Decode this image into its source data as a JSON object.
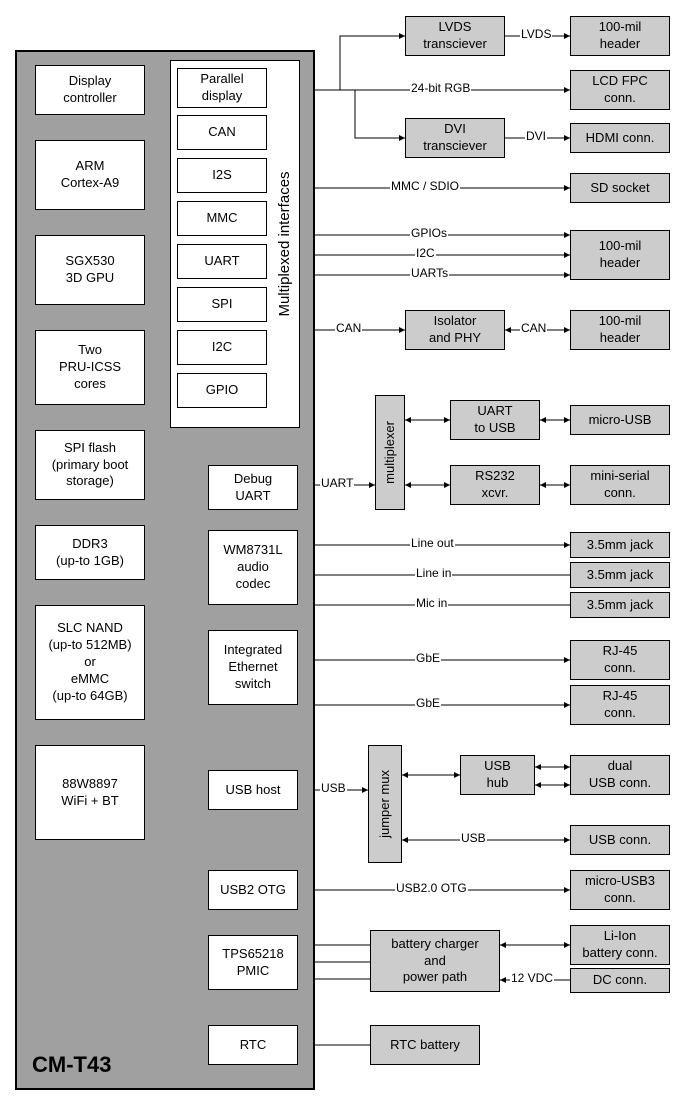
{
  "chip_label": "CM-T43",
  "mux_label": "Multiplexed interfaces",
  "modules": {
    "disp": "Display\ncontroller",
    "arm": "ARM\nCortex-A9",
    "gpu": "SGX530\n3D GPU",
    "pru": "Two\nPRU-ICSS\ncores",
    "spiflash": "SPI flash\n(primary boot\nstorage)",
    "ddr": "DDR3\n(up-to 1GB)",
    "nand": "SLC NAND\n(up-to 512MB)\nor\neMMC\n(up-to 64GB)",
    "wifi": "88W8897\nWiFi + BT"
  },
  "ifaces": {
    "pdisp": "Parallel\ndisplay",
    "can": "CAN",
    "i2s": "I2S",
    "mmc": "MMC",
    "uart": "UART",
    "spi": "SPI",
    "i2c": "I2C",
    "gpio": "GPIO",
    "debug": "Debug\nUART",
    "codec": "WM8731L\naudio\ncodec",
    "eth": "Integrated\nEthernet\nswitch",
    "usbh": "USB host",
    "usb2": "USB2 OTG",
    "pmic": "TPS65218\nPMIC",
    "rtc": "RTC"
  },
  "mids": {
    "lvds": "LVDS\ntransciever",
    "dvi": "DVI\ntransciever",
    "iso": "Isolator\nand PHY",
    "mux": "multiplexer",
    "u2usb": "UART\nto USB",
    "rs232": "RS232\nxcvr.",
    "jmux": "jumper mux",
    "hub": "USB\nhub",
    "bat": "battery charger\nand\npower path",
    "rtcb": "RTC battery"
  },
  "right": {
    "h1": "100-mil\nheader",
    "lcd": "LCD FPC\nconn.",
    "hdmi": "HDMI conn.",
    "sd": "SD socket",
    "h2": "100-mil\nheader",
    "h3": "100-mil\nheader",
    "musb": "micro-USB",
    "mserial": "mini-serial\nconn.",
    "j35a": "3.5mm jack",
    "j35b": "3.5mm jack",
    "j35c": "3.5mm jack",
    "rj1": "RJ-45\nconn.",
    "rj2": "RJ-45\nconn.",
    "dusb": "dual\nUSB conn.",
    "usbc": "USB conn.",
    "musb3": "micro-USB3\nconn.",
    "lion": "Li-Ion\nbattery conn.",
    "dc": "DC conn."
  },
  "lab": {
    "lvds": "LVDS",
    "rgb": "24-bit RGB",
    "dvi": "DVI",
    "mmc": "MMC / SDIO",
    "gpios": "GPIOs",
    "i2c": "I2C",
    "uarts": "UARTs",
    "can": "CAN",
    "can2": "CAN",
    "uart": "UART",
    "lo": "Line out",
    "li": "Line in",
    "mic": "Mic in",
    "gbe1": "GbE",
    "gbe2": "GbE",
    "usb": "USB",
    "usb2": "USB",
    "otg": "USB2.0 OTG",
    "vdc": "12 VDC"
  }
}
